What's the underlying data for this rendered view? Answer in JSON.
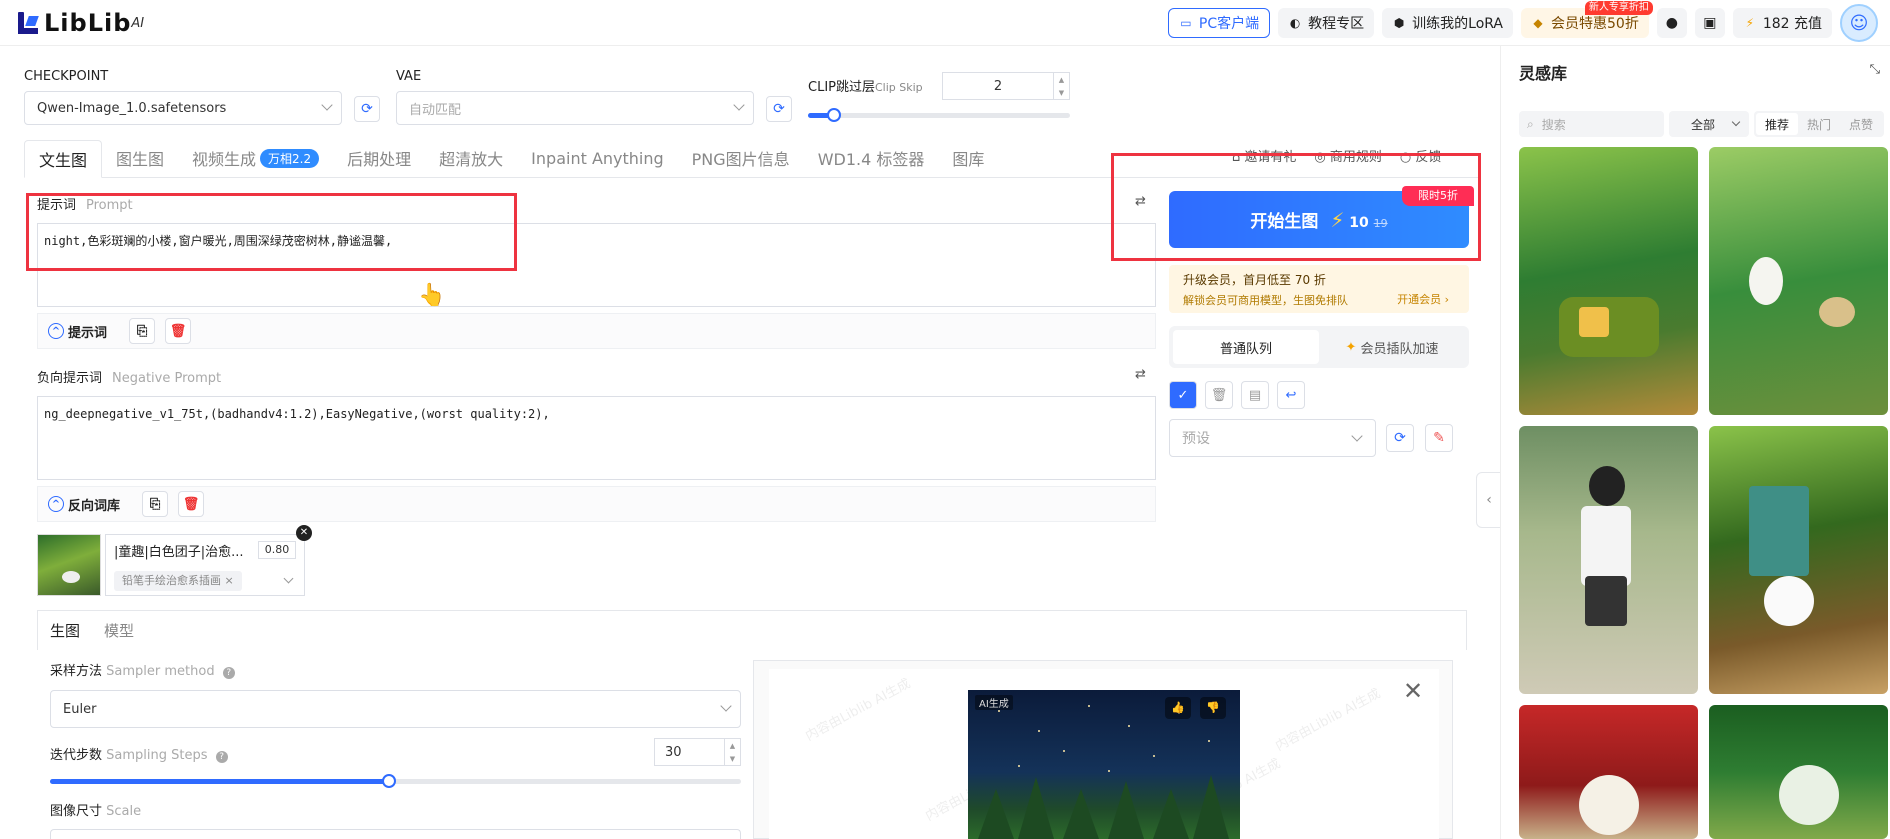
{
  "header": {
    "logo_text": "LibLib",
    "logo_sup": "AI",
    "pc_client": "PC客户端",
    "tutorial": "教程专区",
    "train_lora": "训练我的LoRA",
    "vip_discount": "会员特惠50折",
    "new_user_badge": "新人专享折扣",
    "recharge": "182 充值"
  },
  "model": {
    "checkpoint_label": "CHECKPOINT",
    "checkpoint_value": "Qwen-Image_1.0.safetensors",
    "vae_label": "VAE",
    "vae_placeholder": "自动匹配",
    "clip_label": "CLIP跳过层",
    "clip_label_en": "Clip Skip",
    "clip_value": "2",
    "clip_level": 0.1
  },
  "tabs": [
    {
      "label": "文生图"
    },
    {
      "label": "图生图"
    },
    {
      "label": "视频生成",
      "tag": "万相2.2"
    },
    {
      "label": "后期处理"
    },
    {
      "label": "超清放大"
    },
    {
      "label": "Inpaint Anything"
    },
    {
      "label": "PNG图片信息"
    },
    {
      "label": "WD1.4 标签器"
    },
    {
      "label": "图库"
    }
  ],
  "actions": {
    "invite": "邀请有礼",
    "commercial": "商用规则",
    "feedback": "反馈"
  },
  "prompt": {
    "label": "提示词",
    "label_en": "Prompt",
    "value": "night,色彩斑斓的小楼,窗户暖光,周围深绿茂密树林,静谧温馨,",
    "toggle_label": "提示词"
  },
  "negative": {
    "label": "负向提示词",
    "label_en": "Negative Prompt",
    "value": "ng_deepnegative_v1_75t,(badhandv4:1.2),EasyNegative,(worst quality:2),",
    "toggle_label": "反向词库"
  },
  "lora": {
    "name": "|童趣|白色团子|治愈...",
    "weight": "0.80",
    "tag": "铅笔手绘治愈系插画"
  },
  "generate": {
    "label": "开始生图",
    "cost": "10",
    "old_cost": "19",
    "limited": "限时5折",
    "vip_line1": "升级会员，首月低至 70 折",
    "vip_line2": "解锁会员可商用模型，生图免排队",
    "vip_link": "开通会员 ›",
    "queue_normal": "普通队列",
    "queue_vip": "会员插队加速",
    "preset_placeholder": "预设"
  },
  "settings": {
    "tab_generate": "生图",
    "tab_model": "模型",
    "sampler_label": "采样方法",
    "sampler_label_en": "Sampler method",
    "sampler_value": "Euler",
    "steps_label": "迭代步数",
    "steps_label_en": "Sampling Steps",
    "steps_value": "30",
    "steps_fraction": 0.49,
    "scale_label": "图像尺寸",
    "scale_label_en": "Scale"
  },
  "preview": {
    "ai_tag": "AI生成",
    "watermark": "内容由Liblib AI生成"
  },
  "sidebar": {
    "title": "灵感库",
    "search_placeholder": "搜索",
    "filter": "全部",
    "sort": [
      "推荐",
      "热门",
      "点赞"
    ]
  },
  "colors": {
    "accent": "#2f6bff",
    "highlight": "#ee3340",
    "limited": "#ff2d55"
  }
}
